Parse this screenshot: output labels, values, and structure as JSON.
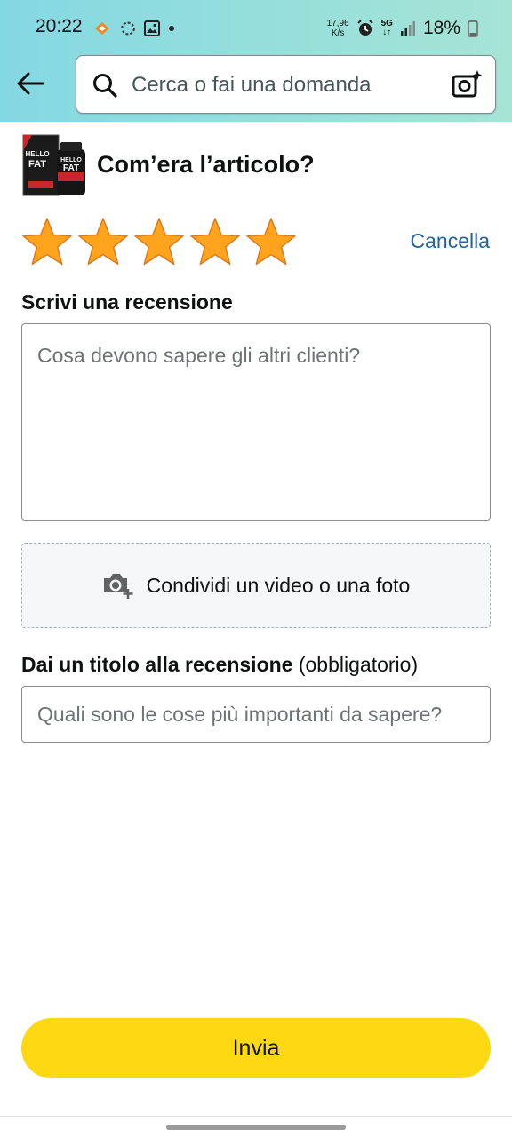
{
  "status_bar": {
    "time": "20:22",
    "net_speed_value": "17,96",
    "net_speed_unit": "K/s",
    "network": "5G",
    "battery": "18%"
  },
  "search": {
    "placeholder": "Cerca o fai una domanda"
  },
  "product": {
    "brand_text": "HELLO FAT"
  },
  "rating": {
    "question": "Com’era l’articolo?",
    "stars_selected": 5,
    "stars_total": 5,
    "star_color": "#ffa41c",
    "clear_label": "Cancella"
  },
  "review": {
    "label": "Scrivi una recensione",
    "placeholder": "Cosa devono sapere gli altri clienti?"
  },
  "media": {
    "label": "Condividi un video o una foto"
  },
  "title_field": {
    "label": "Dai un titolo alla recensione",
    "optional": "(obbligatorio)",
    "placeholder": "Quali sono le cose più importanti da sapere?"
  },
  "submit": {
    "label": "Invia",
    "color": "#ffd814"
  }
}
